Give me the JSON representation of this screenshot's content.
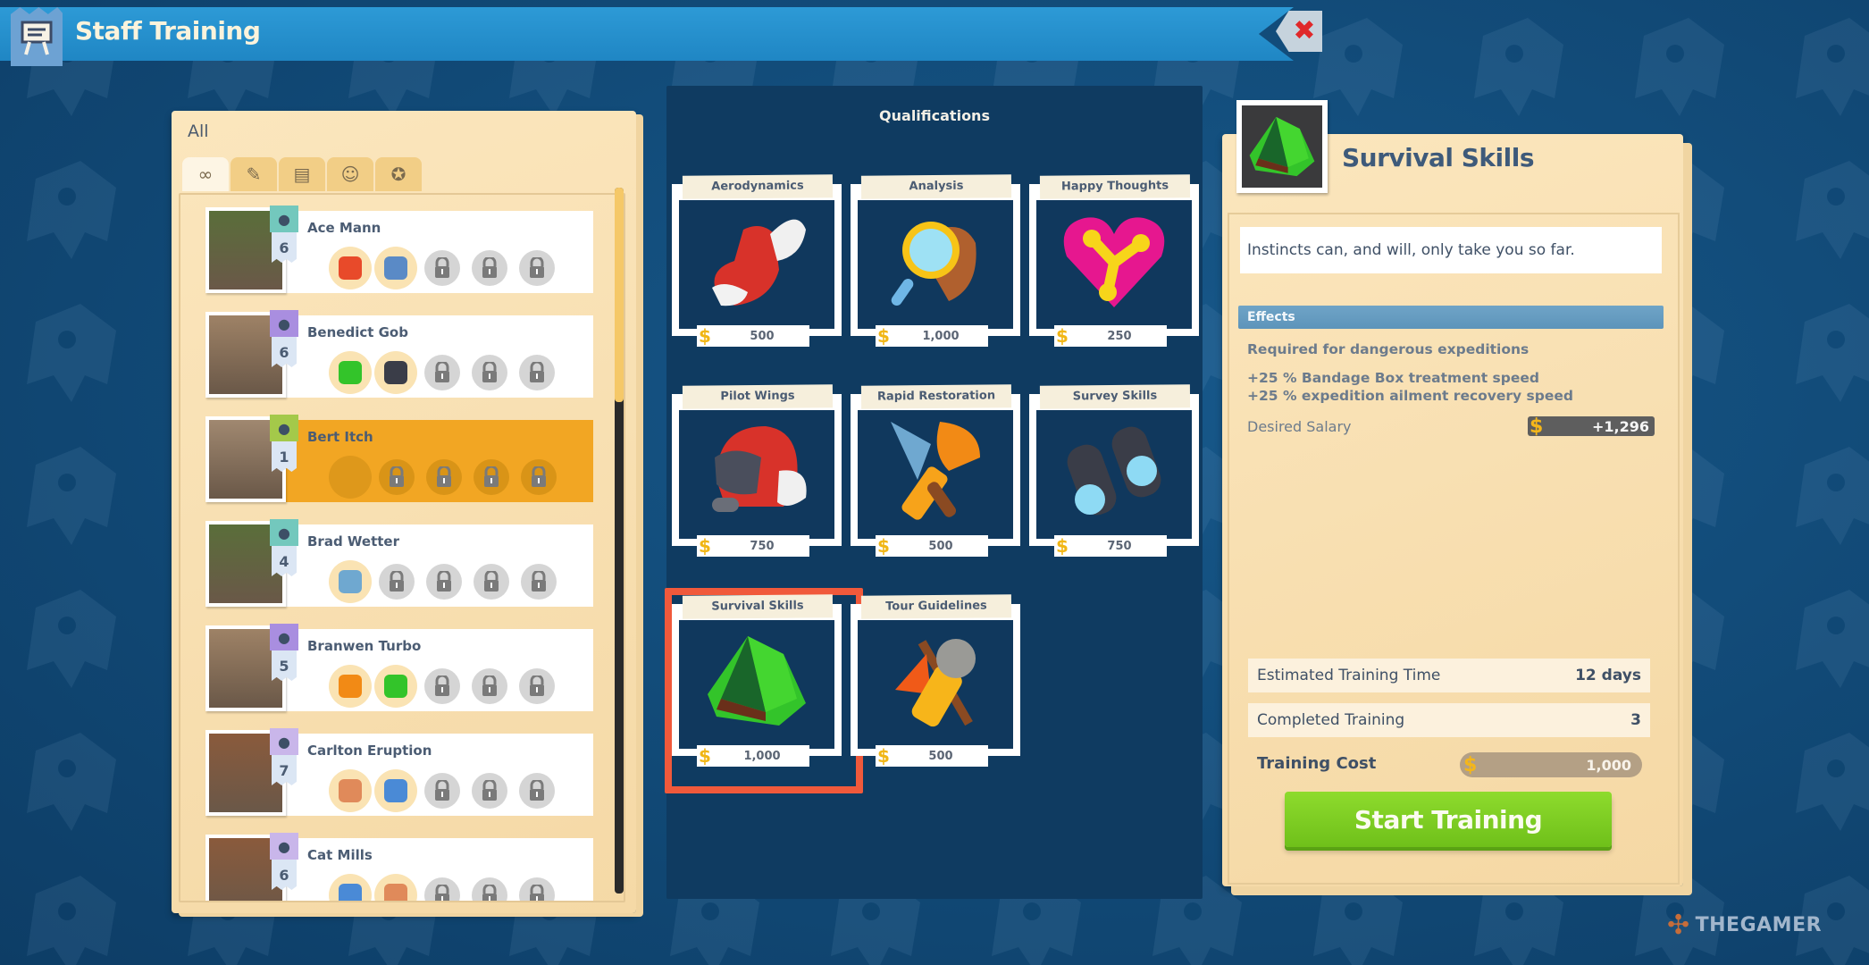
{
  "window": {
    "title": "Staff Training",
    "close_icon": "close-x-icon"
  },
  "staff_panel": {
    "filter_label": "All",
    "tabs": [
      {
        "icon": "infinity-icon",
        "glyph": "∞",
        "active": true
      },
      {
        "icon": "janitor-icon",
        "glyph": "✎",
        "active": false
      },
      {
        "icon": "scientist-icon",
        "glyph": "▤",
        "active": false
      },
      {
        "icon": "guide-icon",
        "glyph": "☺",
        "active": false
      },
      {
        "icon": "security-icon",
        "glyph": "✪",
        "active": false
      }
    ],
    "staff": [
      {
        "name": "Ace Mann",
        "level": "6",
        "role_icon": "bucket-icon",
        "role_color": "#73c8bd",
        "portrait_color": "#5a6e3a",
        "selected": false,
        "slots": [
          {
            "type": "filled",
            "icon": "rocket-icon",
            "glyph": "🚀"
          },
          {
            "type": "filled",
            "icon": "gear-upgrade-icon",
            "glyph": "⚙"
          },
          {
            "type": "locked"
          },
          {
            "type": "locked"
          },
          {
            "type": "locked"
          }
        ]
      },
      {
        "name": "Benedict Gob",
        "level": "6",
        "role_icon": "hat-icon",
        "role_color": "#a98ee0",
        "portrait_color": "#9e8266",
        "selected": false,
        "slots": [
          {
            "type": "filled",
            "icon": "tent-icon",
            "glyph": "⛺"
          },
          {
            "type": "filled",
            "icon": "binoculars-icon",
            "glyph": "◎"
          },
          {
            "type": "locked"
          },
          {
            "type": "locked"
          },
          {
            "type": "locked"
          }
        ]
      },
      {
        "name": "Bert Itch",
        "level": "1",
        "role_icon": "plant-icon",
        "role_color": "#a4c94a",
        "portrait_color": "#a08870",
        "selected": true,
        "slots": [
          {
            "type": "empty"
          },
          {
            "type": "locked"
          },
          {
            "type": "locked"
          },
          {
            "type": "locked"
          },
          {
            "type": "locked"
          }
        ]
      },
      {
        "name": "Brad Wetter",
        "level": "4",
        "role_icon": "bucket-icon",
        "role_color": "#73c8bd",
        "portrait_color": "#5a6e3a",
        "selected": false,
        "slots": [
          {
            "type": "filled",
            "icon": "hammer-icon",
            "glyph": "🔨"
          },
          {
            "type": "locked"
          },
          {
            "type": "locked"
          },
          {
            "type": "locked"
          },
          {
            "type": "locked"
          }
        ]
      },
      {
        "name": "Branwen Turbo",
        "level": "5",
        "role_icon": "hat-icon",
        "role_color": "#a98ee0",
        "portrait_color": "#9e8266",
        "selected": false,
        "slots": [
          {
            "type": "filled",
            "icon": "trowel-brush-icon",
            "glyph": "⚒"
          },
          {
            "type": "filled",
            "icon": "tent-icon",
            "glyph": "⛺"
          },
          {
            "type": "locked"
          },
          {
            "type": "locked"
          },
          {
            "type": "locked"
          }
        ]
      },
      {
        "name": "Carlton Eruption",
        "level": "7",
        "role_icon": "id-card-icon",
        "role_color": "#c9b6ea",
        "portrait_color": "#8a5a3c",
        "selected": false,
        "slots": [
          {
            "type": "filled",
            "icon": "speech-person-icon",
            "glyph": "☺"
          },
          {
            "type": "filled",
            "icon": "book-upgrade-icon",
            "glyph": "✉"
          },
          {
            "type": "locked"
          },
          {
            "type": "locked"
          },
          {
            "type": "locked"
          }
        ]
      },
      {
        "name": "Cat Mills",
        "level": "6",
        "role_icon": "id-card-icon",
        "role_color": "#c9b6ea",
        "portrait_color": "#8a5a3c",
        "selected": false,
        "slots": [
          {
            "type": "filled",
            "icon": "book-upgrade-icon",
            "glyph": "✉"
          },
          {
            "type": "filled",
            "icon": "speech-person-icon",
            "glyph": "☺"
          },
          {
            "type": "locked"
          },
          {
            "type": "locked"
          },
          {
            "type": "locked"
          }
        ]
      }
    ],
    "lock_glyph": "🔒"
  },
  "qualifications": {
    "title": "Qualifications",
    "currency_glyph": "$",
    "items": [
      {
        "name": "Aerodynamics",
        "price": "500",
        "icon": "winged-shoe-icon",
        "selected": false
      },
      {
        "name": "Analysis",
        "price": "1,000",
        "icon": "magnifying-glass-icon",
        "selected": false
      },
      {
        "name": "Happy Thoughts",
        "price": "250",
        "icon": "heart-icon",
        "selected": false
      },
      {
        "name": "Pilot Wings",
        "price": "750",
        "icon": "pilot-helmet-icon",
        "selected": false
      },
      {
        "name": "Rapid Restoration",
        "price": "500",
        "icon": "trowel-brush-icon",
        "selected": false
      },
      {
        "name": "Survey Skills",
        "price": "750",
        "icon": "binoculars-icon",
        "selected": false
      },
      {
        "name": "Survival Skills",
        "price": "1,000",
        "icon": "tent-icon",
        "selected": true
      },
      {
        "name": "Tour Guidelines",
        "price": "500",
        "icon": "microphone-flag-icon",
        "selected": false
      }
    ]
  },
  "detail": {
    "title": "Survival Skills",
    "icon": "tent-icon",
    "description": "Instincts can, and will, only take you so far.",
    "effects_header": "Effects",
    "effects": [
      "Required for dangerous expeditions",
      "+25 % Bandage Box treatment speed",
      "+25 % expedition ailment recovery speed"
    ],
    "salary_label": "Desired Salary",
    "salary_value": "+1,296",
    "estimated_time_label": "Estimated Training Time",
    "estimated_time_value": "12 days",
    "completed_label": "Completed Training",
    "completed_value": "3",
    "cost_label": "Training Cost",
    "cost_value": "1,000",
    "start_button": "Start Training",
    "currency_glyph": "$"
  },
  "watermark": {
    "text": "THEGAMER",
    "logo_glyph": "✣"
  }
}
